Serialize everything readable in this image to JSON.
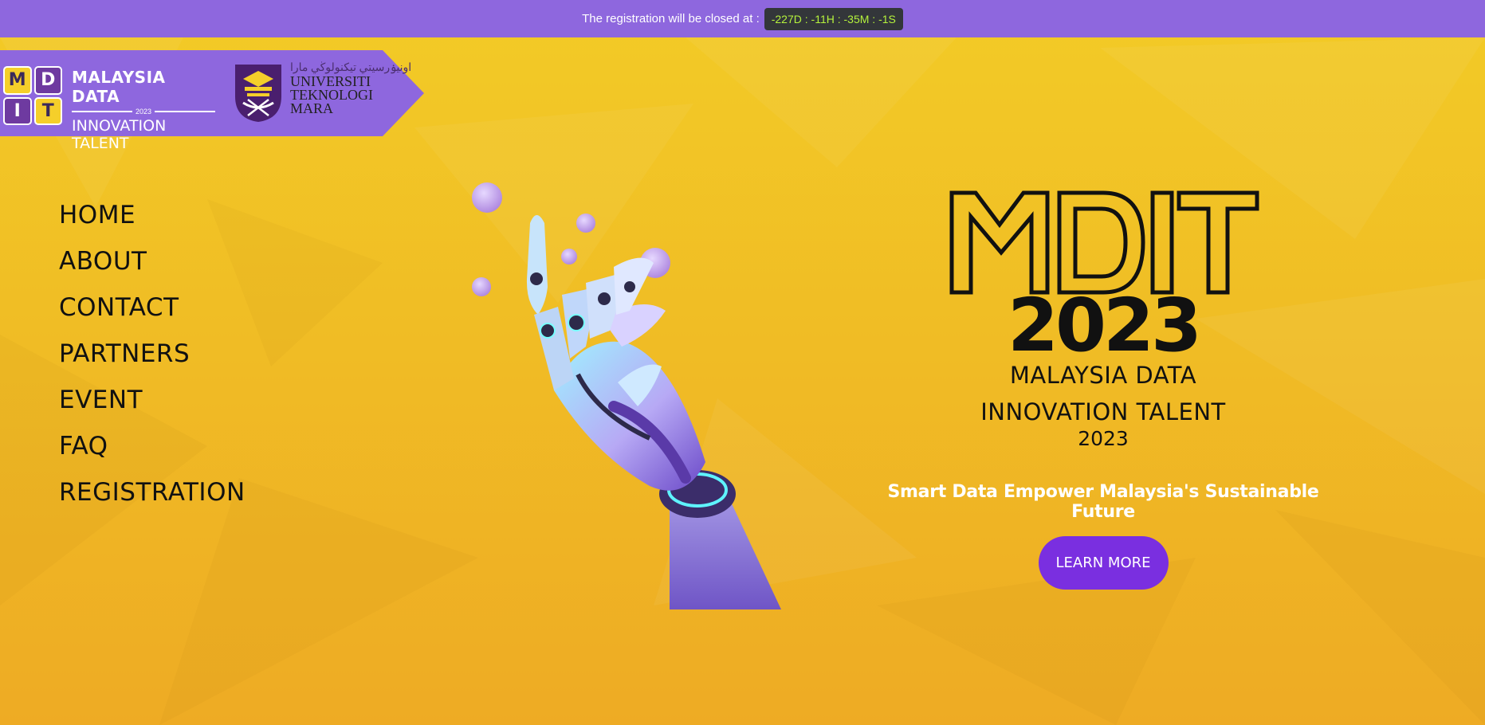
{
  "topbar": {
    "message": "The registration will be closed at :",
    "countdown": "-227D : -11H : -35M : -1S"
  },
  "logo": {
    "tiles": [
      "M",
      "D",
      "I",
      "T"
    ],
    "line1": "MALAYSIA DATA",
    "year": "2023",
    "line2": "INNOVATION TALENT",
    "uitm_arabic": "اونيۏرسيتي تيكنولوڬي مارا",
    "uitm_line1": "UNIVERSITI",
    "uitm_line2": "TEKNOLOGI",
    "uitm_line3": "MARA"
  },
  "nav": {
    "items": [
      "HOME",
      "ABOUT",
      "CONTACT",
      "PARTNERS",
      "EVENT",
      "FAQ",
      "REGISTRATION"
    ]
  },
  "hero": {
    "logo_word": "MDIT",
    "logo_year": "2023",
    "subtitle1": "MALAYSIA DATA",
    "subtitle2": "INNOVATION TALENT",
    "subtitle3": "2023",
    "tagline": "Smart Data Empower Malaysia's Sustainable Future",
    "button": "LEARN MORE"
  },
  "colors": {
    "banner": "#8e67de",
    "countdown_bg": "#33363a",
    "countdown_text": "#b5f33c",
    "background": "#f0bd25",
    "button": "#7a2fe0"
  }
}
